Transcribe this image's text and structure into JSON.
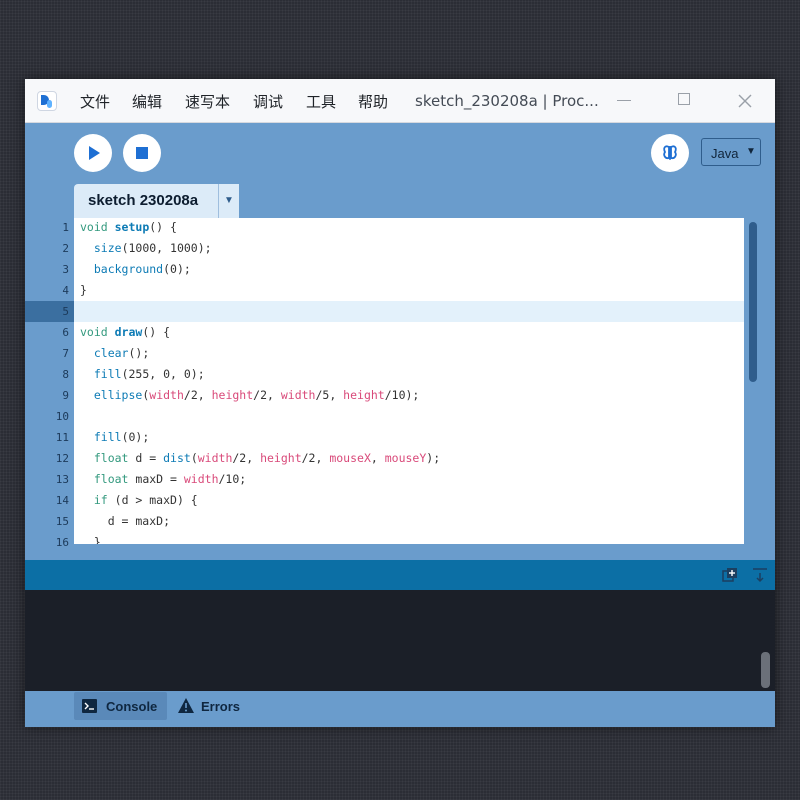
{
  "menu": [
    "文件",
    "编辑",
    "速写本",
    "调试",
    "工具",
    "帮助"
  ],
  "window": {
    "title": "sketch_230208a | Proc..."
  },
  "toolbar": {
    "mode": "Java"
  },
  "tabs": [
    {
      "label": "sketch 230208a",
      "active": true
    }
  ],
  "editor": {
    "current_line": 5,
    "lines": [
      {
        "n": "1",
        "tokens": [
          [
            "kw",
            "void "
          ],
          [
            "fnb",
            "setup"
          ],
          [
            "pl",
            "() {"
          ]
        ]
      },
      {
        "n": "2",
        "tokens": [
          [
            "pl",
            "  "
          ],
          [
            "fn",
            "size"
          ],
          [
            "pl",
            "(1000, 1000);"
          ]
        ]
      },
      {
        "n": "3",
        "tokens": [
          [
            "pl",
            "  "
          ],
          [
            "fn",
            "background"
          ],
          [
            "pl",
            "(0);"
          ]
        ]
      },
      {
        "n": "4",
        "tokens": [
          [
            "pl",
            "}"
          ]
        ]
      },
      {
        "n": "5",
        "tokens": []
      },
      {
        "n": "6",
        "tokens": [
          [
            "kw",
            "void "
          ],
          [
            "fnb",
            "draw"
          ],
          [
            "pl",
            "() {"
          ]
        ]
      },
      {
        "n": "7",
        "tokens": [
          [
            "pl",
            "  "
          ],
          [
            "fn",
            "clear"
          ],
          [
            "pl",
            "();"
          ]
        ]
      },
      {
        "n": "8",
        "tokens": [
          [
            "pl",
            "  "
          ],
          [
            "fn",
            "fill"
          ],
          [
            "pl",
            "(255, 0, 0);"
          ]
        ]
      },
      {
        "n": "9",
        "tokens": [
          [
            "pl",
            "  "
          ],
          [
            "fn",
            "ellipse"
          ],
          [
            "pl",
            "("
          ],
          [
            "var",
            "width"
          ],
          [
            "pl",
            "/2, "
          ],
          [
            "var",
            "height"
          ],
          [
            "pl",
            "/2, "
          ],
          [
            "var",
            "width"
          ],
          [
            "pl",
            "/5, "
          ],
          [
            "var",
            "height"
          ],
          [
            "pl",
            "/10);"
          ]
        ]
      },
      {
        "n": "10",
        "tokens": []
      },
      {
        "n": "11",
        "tokens": [
          [
            "pl",
            "  "
          ],
          [
            "fn",
            "fill"
          ],
          [
            "pl",
            "(0);"
          ]
        ]
      },
      {
        "n": "12",
        "tokens": [
          [
            "pl",
            "  "
          ],
          [
            "kw",
            "float"
          ],
          [
            "pl",
            " d = "
          ],
          [
            "fn",
            "dist"
          ],
          [
            "pl",
            "("
          ],
          [
            "var",
            "width"
          ],
          [
            "pl",
            "/2, "
          ],
          [
            "var",
            "height"
          ],
          [
            "pl",
            "/2, "
          ],
          [
            "var",
            "mouseX"
          ],
          [
            "pl",
            ", "
          ],
          [
            "var",
            "mouseY"
          ],
          [
            "pl",
            ");"
          ]
        ]
      },
      {
        "n": "13",
        "tokens": [
          [
            "pl",
            "  "
          ],
          [
            "kw",
            "float"
          ],
          [
            "pl",
            " maxD = "
          ],
          [
            "var",
            "width"
          ],
          [
            "pl",
            "/10;"
          ]
        ]
      },
      {
        "n": "14",
        "tokens": [
          [
            "pl",
            "  "
          ],
          [
            "kw",
            "if"
          ],
          [
            "pl",
            " (d > maxD) {"
          ]
        ]
      },
      {
        "n": "15",
        "tokens": [
          [
            "pl",
            "    d = maxD;"
          ]
        ]
      },
      {
        "n": "16",
        "tokens": [
          [
            "pl",
            "  }"
          ]
        ]
      }
    ]
  },
  "footer": {
    "console_label": "Console",
    "errors_label": "Errors"
  },
  "colors": {
    "accent": "#1e6fd3",
    "panel": "#6a9ccc",
    "console_bar": "#0c6fa5",
    "console_bg": "#1b1f28"
  }
}
